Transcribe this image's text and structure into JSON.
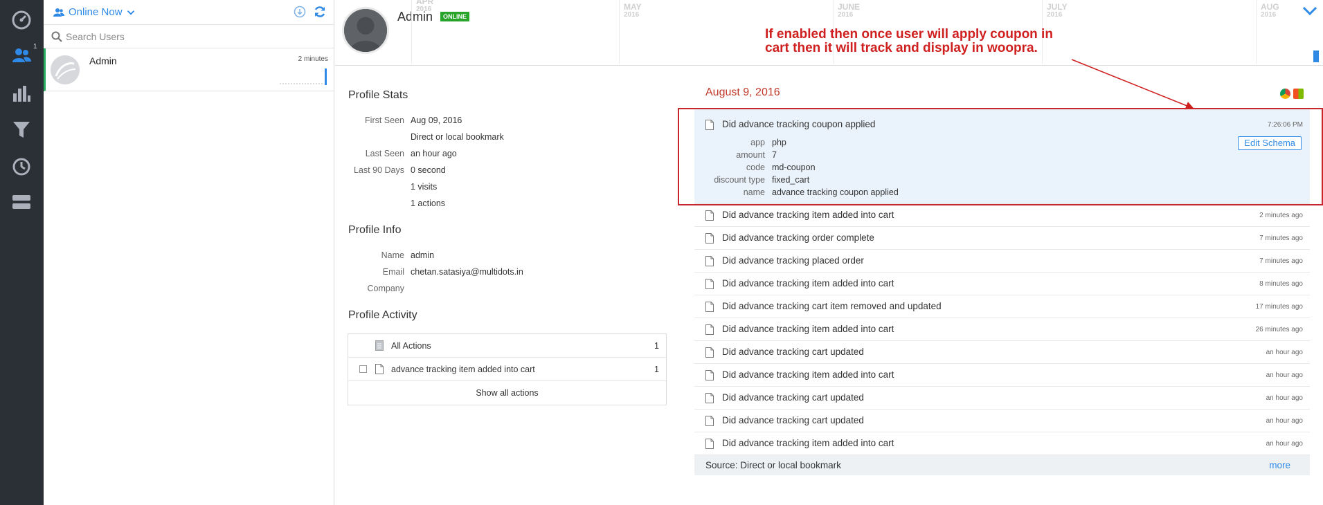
{
  "rail": {
    "badge": "1",
    "icons": [
      "dashboard-icon",
      "people-icon",
      "bar-chart-icon",
      "funnel-icon",
      "retention-icon",
      "toggle-icon"
    ]
  },
  "users": {
    "filter_label": "Online Now",
    "search_placeholder": "Search Users",
    "list": [
      {
        "name": "Admin",
        "time": "2 minutes"
      }
    ]
  },
  "profile": {
    "name": "Admin",
    "status_badge": "ONLINE",
    "timeline": [
      {
        "month": "APR",
        "year": "2016"
      },
      {
        "month": "MAY",
        "year": "2016"
      },
      {
        "month": "JUNE",
        "year": "2016"
      },
      {
        "month": "JULY",
        "year": "2016"
      },
      {
        "month": "AUG",
        "year": "2016"
      }
    ]
  },
  "stats": {
    "title": "Profile Stats",
    "first_seen_label": "First Seen",
    "first_seen": "Aug 09, 2016",
    "first_seen_source": "Direct or local bookmark",
    "last_seen_label": "Last Seen",
    "last_seen": "an hour ago",
    "last90_label": "Last 90 Days",
    "last90_time": "0 second",
    "last90_visits": "1 visits",
    "last90_actions": "1 actions"
  },
  "info": {
    "title": "Profile Info",
    "name_label": "Name",
    "name": "admin",
    "email_label": "Email",
    "email": "chetan.satasiya@multidots.in",
    "company_label": "Company"
  },
  "activity": {
    "title": "Profile Activity",
    "rows": [
      {
        "label": "All Actions",
        "count": "1"
      },
      {
        "label": "advance tracking item added into cart",
        "count": "1"
      }
    ],
    "show_all": "Show all actions"
  },
  "events": {
    "date": "August 9, 2016",
    "expanded": {
      "title": "Did advance tracking coupon applied",
      "time": "7:26:06 PM",
      "edit_schema": "Edit Schema",
      "props": [
        {
          "key": "app",
          "value": "php"
        },
        {
          "key": "amount",
          "value": "7"
        },
        {
          "key": "code",
          "value": "md-coupon"
        },
        {
          "key": "discount type",
          "value": "fixed_cart"
        },
        {
          "key": "name",
          "value": "advance tracking coupon applied"
        }
      ]
    },
    "list": [
      {
        "title": "Did advance tracking item added into cart",
        "time": "2 minutes ago"
      },
      {
        "title": "Did advance tracking order complete",
        "time": "7 minutes ago"
      },
      {
        "title": "Did advance tracking placed order",
        "time": "7 minutes ago"
      },
      {
        "title": "Did advance tracking item added into cart",
        "time": "8 minutes ago"
      },
      {
        "title": "Did advance tracking cart item removed and updated",
        "time": "17 minutes ago"
      },
      {
        "title": "Did advance tracking item added into cart",
        "time": "26 minutes ago"
      },
      {
        "title": "Did advance tracking cart updated",
        "time": "an hour ago"
      },
      {
        "title": "Did advance tracking item added into cart",
        "time": "an hour ago"
      },
      {
        "title": "Did advance tracking cart updated",
        "time": "an hour ago"
      },
      {
        "title": "Did advance tracking cart updated",
        "time": "an hour ago"
      },
      {
        "title": "Did advance tracking item added into cart",
        "time": "an hour ago"
      }
    ],
    "source": "Source: Direct or local bookmark",
    "more": "more"
  },
  "annotation": {
    "line1": "If enabled then once user will apply coupon in",
    "line2": "cart then it will track and display in woopra."
  },
  "colors": {
    "accent": "#2e8ae6",
    "online": "#28a428",
    "annotation": "#d01f1f",
    "rail": "#2b2f36"
  }
}
